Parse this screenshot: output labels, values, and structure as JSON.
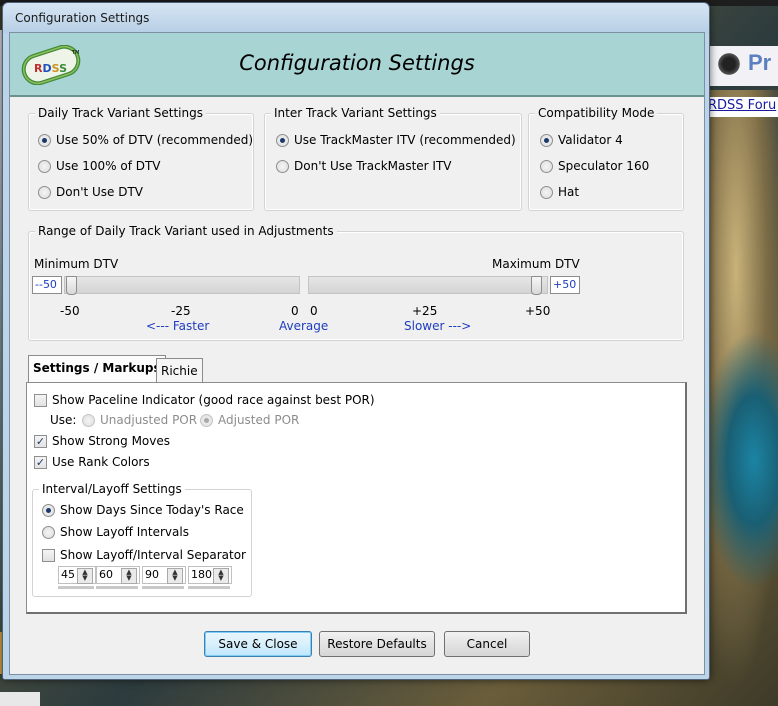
{
  "window": {
    "title": "Configuration Settings"
  },
  "header": {
    "title": "Configuration Settings",
    "logo_text": "RDSS",
    "logo_tm": "TM"
  },
  "background": {
    "link_text": "RDSS Foru",
    "banner_text": "Pr"
  },
  "dtv_settings": {
    "title": "Daily Track Variant Settings",
    "options": [
      {
        "label": "Use 50% of DTV (recommended)",
        "selected": true
      },
      {
        "label": "Use 100% of DTV",
        "selected": false
      },
      {
        "label": "Don't Use DTV",
        "selected": false
      }
    ]
  },
  "itv_settings": {
    "title": "Inter Track Variant Settings",
    "options": [
      {
        "label": "Use TrackMaster ITV (recommended)",
        "selected": true
      },
      {
        "label": "Don't Use TrackMaster ITV",
        "selected": false
      }
    ]
  },
  "compat_mode": {
    "title": "Compatibility Mode",
    "options": [
      {
        "label": "Validator 4",
        "selected": true
      },
      {
        "label": "Speculator 160",
        "selected": false
      },
      {
        "label": "Hat",
        "selected": false
      }
    ]
  },
  "range": {
    "title": "Range of Daily Track Variant used in Adjustments",
    "min_label": "Minimum DTV",
    "max_label": "Maximum DTV",
    "min_value": "--50",
    "max_value": "+50",
    "min_ticks": [
      "-50",
      "-25",
      "0"
    ],
    "max_ticks": [
      "0",
      "+25",
      "+50"
    ],
    "faster_label": "<--- Faster",
    "average_label": "Average",
    "slower_label": "Slower --->",
    "min_slider_fraction": 0,
    "max_slider_fraction": 1
  },
  "tabs": [
    {
      "label": "Settings / Markups",
      "active": true
    },
    {
      "label": "Richie",
      "active": false
    }
  ],
  "markups": {
    "paceline": {
      "label": "Show Paceline Indicator (good race against best POR)",
      "checked": false
    },
    "use_label": "Use:",
    "por_options": [
      {
        "label": "Unadjusted POR",
        "selected": false
      },
      {
        "label": "Adjusted POR",
        "selected": true
      }
    ],
    "strong_moves": {
      "label": "Show Strong Moves",
      "checked": true
    },
    "rank_colors": {
      "label": "Use Rank Colors",
      "checked": true
    }
  },
  "interval": {
    "title": "Interval/Layoff Settings",
    "options": [
      {
        "label": "Show Days Since Today's Race",
        "selected": true
      },
      {
        "label": "Show Layoff Intervals",
        "selected": false
      }
    ],
    "separator": {
      "label": "Show Layoff/Interval Separator",
      "checked": false
    },
    "spinners": [
      "45",
      "60",
      "90",
      "180"
    ]
  },
  "buttons": {
    "save": "Save & Close",
    "restore": "Restore Defaults",
    "cancel": "Cancel"
  },
  "check_glyph": "✓"
}
